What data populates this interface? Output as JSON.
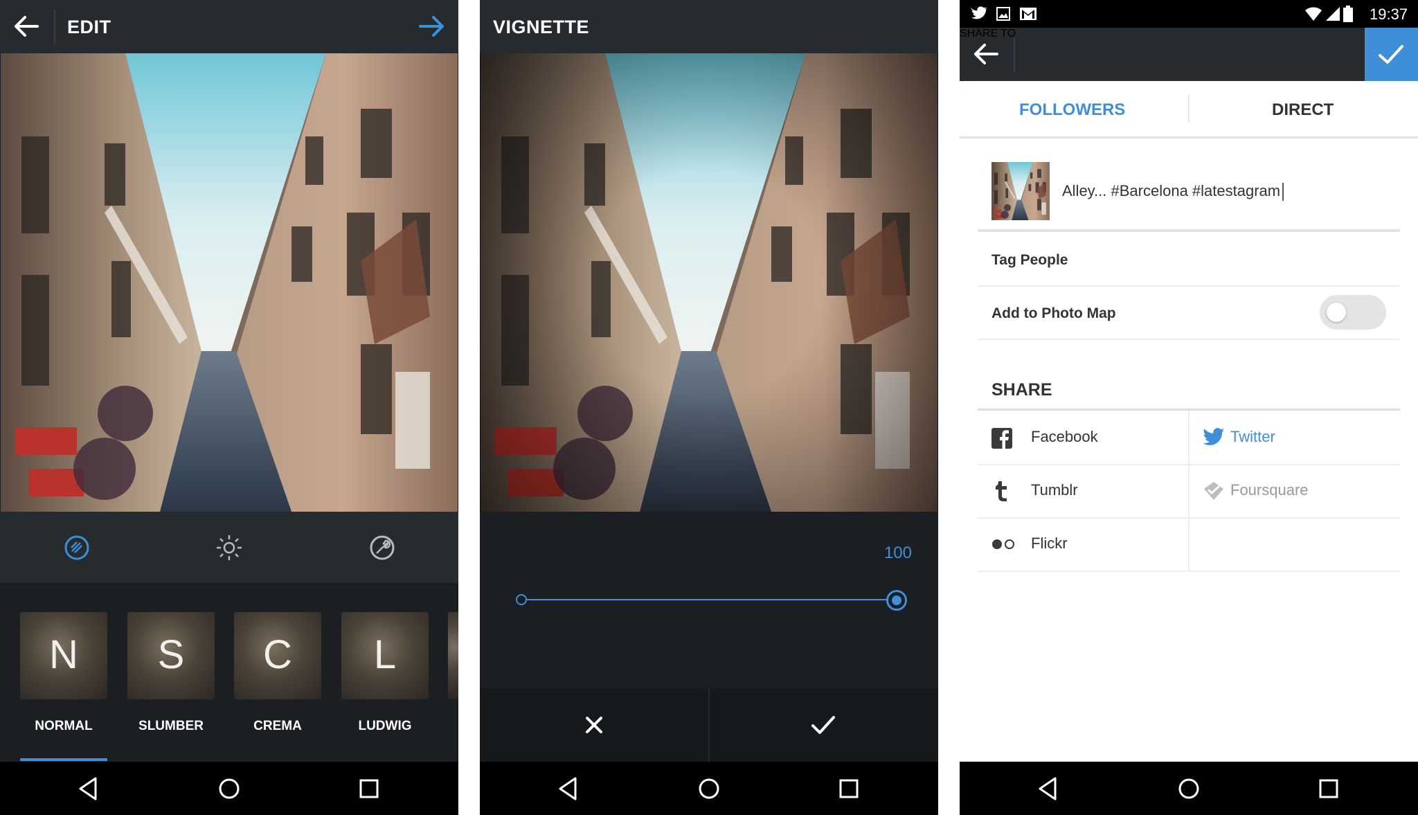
{
  "panel_edit": {
    "title": "EDIT",
    "tools": [
      "filter-icon",
      "brightness-icon",
      "adjust-wrench-icon"
    ],
    "filters": [
      {
        "letter": "N",
        "name": "NORMAL",
        "selected": true
      },
      {
        "letter": "S",
        "name": "SLUMBER",
        "selected": false
      },
      {
        "letter": "C",
        "name": "CREMA",
        "selected": false
      },
      {
        "letter": "L",
        "name": "LUDWIG",
        "selected": false
      }
    ]
  },
  "panel_vignette": {
    "title": "VIGNETTE",
    "slider_value": "100",
    "slider_fraction": 1.0
  },
  "panel_share": {
    "status": {
      "time": "19:37",
      "icons": [
        "twitter-icon",
        "gallery-icon",
        "gmail-icon",
        "wifi-icon",
        "signal-icon",
        "battery-icon"
      ]
    },
    "title": "SHARE TO",
    "tabs": {
      "followers": "FOLLOWERS",
      "direct": "DIRECT",
      "active": "followers"
    },
    "caption": "Alley... #Barcelona #latestagram",
    "tag_people": "Tag People",
    "photo_map": {
      "label": "Add to Photo Map",
      "enabled": false
    },
    "share_heading": "SHARE",
    "share_targets": [
      {
        "name": "Facebook",
        "active": false
      },
      {
        "name": "Twitter",
        "active": true
      },
      {
        "name": "Tumblr",
        "active": false
      },
      {
        "name": "Foursquare",
        "active": false
      },
      {
        "name": "Flickr",
        "active": false
      }
    ]
  },
  "colors": {
    "accent": "#3f8fd8",
    "dark_bg": "#1b1f23",
    "bar_bg": "#262b30",
    "muted_text": "#999999"
  }
}
